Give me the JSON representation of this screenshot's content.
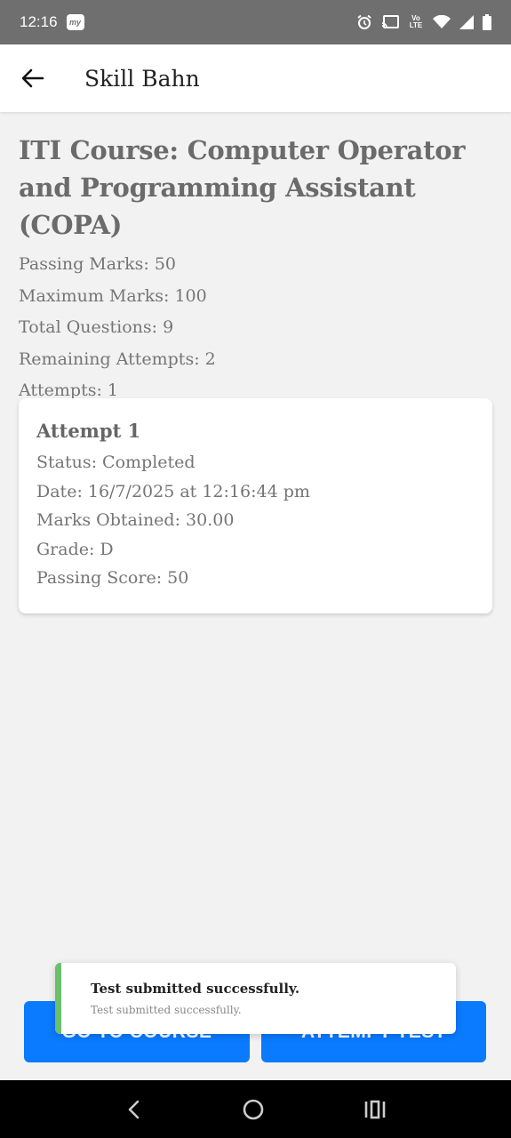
{
  "status_bar": {
    "time": "12:16",
    "app_badge": "my",
    "network": "Vo LTE"
  },
  "app_bar": {
    "title": "Skill Bahn",
    "back_icon": "arrow-left-icon"
  },
  "course": {
    "title": "ITI Course: Computer Operator and Programming Assistant (COPA)",
    "passing_marks": "Passing Marks: 50",
    "maximum_marks": "Maximum Marks: 100",
    "total_questions": "Total Questions: 9",
    "remaining_attempts": "Remaining Attempts: 2",
    "attempts": "Attempts: 1"
  },
  "attempt_card": {
    "title": "Attempt 1",
    "status": "Status: Completed",
    "date": "Date: 16/7/2025 at 12:16:44 pm",
    "marks": "Marks Obtained: 30.00",
    "grade": "Grade: D",
    "passing_score": "Passing Score: 50"
  },
  "buttons": {
    "go_to_course": "GO TO COURSE",
    "attempt_test": "ATTEMPT TEST"
  },
  "toast": {
    "title": "Test submitted successfully.",
    "body": "Test submitted successfully.",
    "accent_color": "#6abf6a"
  },
  "colors": {
    "primary": "#0a7aff",
    "status_bar": "#6f6f6f"
  }
}
